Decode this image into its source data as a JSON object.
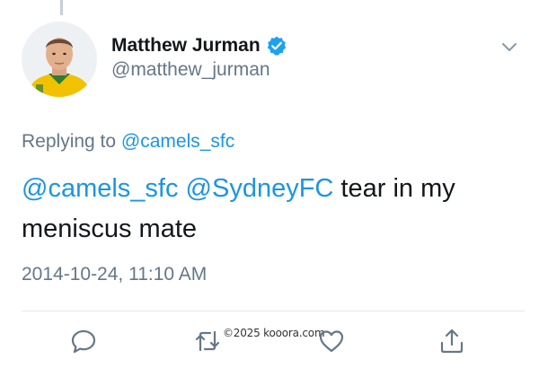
{
  "author": {
    "display_name": "Matthew Jurman",
    "handle": "@matthew_jurman",
    "verified": true
  },
  "reply_context": {
    "prefix": "Replying to ",
    "mention": "@camels_sfc"
  },
  "tweet": {
    "mention_1": "@camels_sfc",
    "mention_2": "@SydneyFC",
    "text": " tear in my meniscus mate"
  },
  "timestamp": "2014-10-24, 11:10 AM",
  "watermark": "©2025 kooora.com",
  "icons": {
    "more": "chevron-down-icon",
    "reply": "reply-icon",
    "retweet": "retweet-icon",
    "like": "heart-icon",
    "share": "share-icon",
    "verified": "verified-badge-icon"
  },
  "colors": {
    "link": "#1b95e0",
    "secondary_text": "#657786",
    "primary_text": "#14171a",
    "verified": "#1da1f2"
  }
}
